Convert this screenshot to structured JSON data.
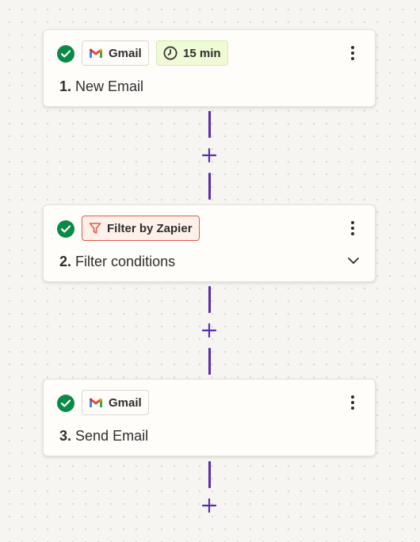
{
  "steps": [
    {
      "number": "1.",
      "title": "New Email",
      "app_label": "Gmail",
      "app_icon": "gmail-icon",
      "timer_label": "15 min",
      "status": "complete"
    },
    {
      "number": "2.",
      "title": "Filter conditions",
      "app_label": "Filter by Zapier",
      "app_icon": "filter-icon",
      "status": "complete",
      "expandable": true
    },
    {
      "number": "3.",
      "title": "Send Email",
      "app_label": "Gmail",
      "app_icon": "gmail-icon",
      "status": "complete"
    }
  ],
  "colors": {
    "check": "#0b8a47",
    "connector": "#5b2dad",
    "filter_border": "#e05a47",
    "timer_bg": "#effad6"
  }
}
